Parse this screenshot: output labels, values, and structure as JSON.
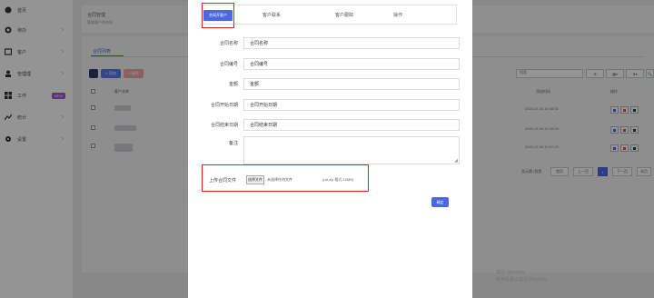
{
  "sidebar": {
    "items": [
      {
        "label": "首页",
        "icon": "dashboard-icon",
        "arrow": ""
      },
      {
        "label": "待办",
        "icon": "clock-icon",
        "arrow": "›"
      },
      {
        "label": "客户",
        "icon": "customer-icon",
        "arrow": "›"
      },
      {
        "label": "管理理",
        "icon": "team-icon",
        "arrow": "›"
      },
      {
        "label": "工作",
        "icon": "grid-icon",
        "arrow": "",
        "badge": "NEW"
      },
      {
        "label": "统计",
        "icon": "chart-icon",
        "arrow": "›"
      },
      {
        "label": "设置",
        "icon": "gear-icon",
        "arrow": "›"
      }
    ]
  },
  "page": {
    "title": "合同管理",
    "subtitle": "管理客户的合同",
    "tab_label": "合同列表",
    "add_label": "+ 添加",
    "delete_label": "× 删除",
    "search_placeholder": "搜索",
    "tools": [
      "⊕",
      "▦▾",
      "⬇▾",
      "🔍"
    ],
    "columns": [
      "客户名称",
      "添加时间",
      "操作"
    ],
    "rows": [
      {
        "time": "2020-11-04 10:38:31"
      },
      {
        "time": "2020-11-04 10:20:03"
      },
      {
        "time": "2020-11-04 10:07:20"
      }
    ],
    "pager_info": "显示第1到第",
    "pager": {
      "first": "首页",
      "prev": "上一页",
      "current": "1",
      "next": "下一页",
      "last": "末页"
    },
    "watermark": [
      "激活 Windows",
      "转到设置以激活 Windows"
    ]
  },
  "modal": {
    "tabs": [
      "合同开客户",
      "客户联系",
      "客户跟踪",
      "操作"
    ],
    "fields": [
      {
        "label": "合同名称",
        "value": "合同名称"
      },
      {
        "label": "合同编号",
        "value": "合同编号"
      },
      {
        "label": "金额",
        "value": "金额"
      },
      {
        "label": "合同开始日期",
        "value": "合同开始日期"
      },
      {
        "label": "合同结束日期",
        "value": "合同结束日期"
      }
    ],
    "remark_label": "备注",
    "upload_label": "上传合同文件",
    "choose_file": "选择文件",
    "no_file": "未选择任何文件",
    "upload_hint": "(rar,zip 格式,10MB)",
    "submit": "确定"
  },
  "colors": {
    "accent": "#4b67e6",
    "highlight_box": "#e0241f",
    "badge": "#9b59d0",
    "danger": "#e05555",
    "refresh": "#2f3c6a"
  }
}
